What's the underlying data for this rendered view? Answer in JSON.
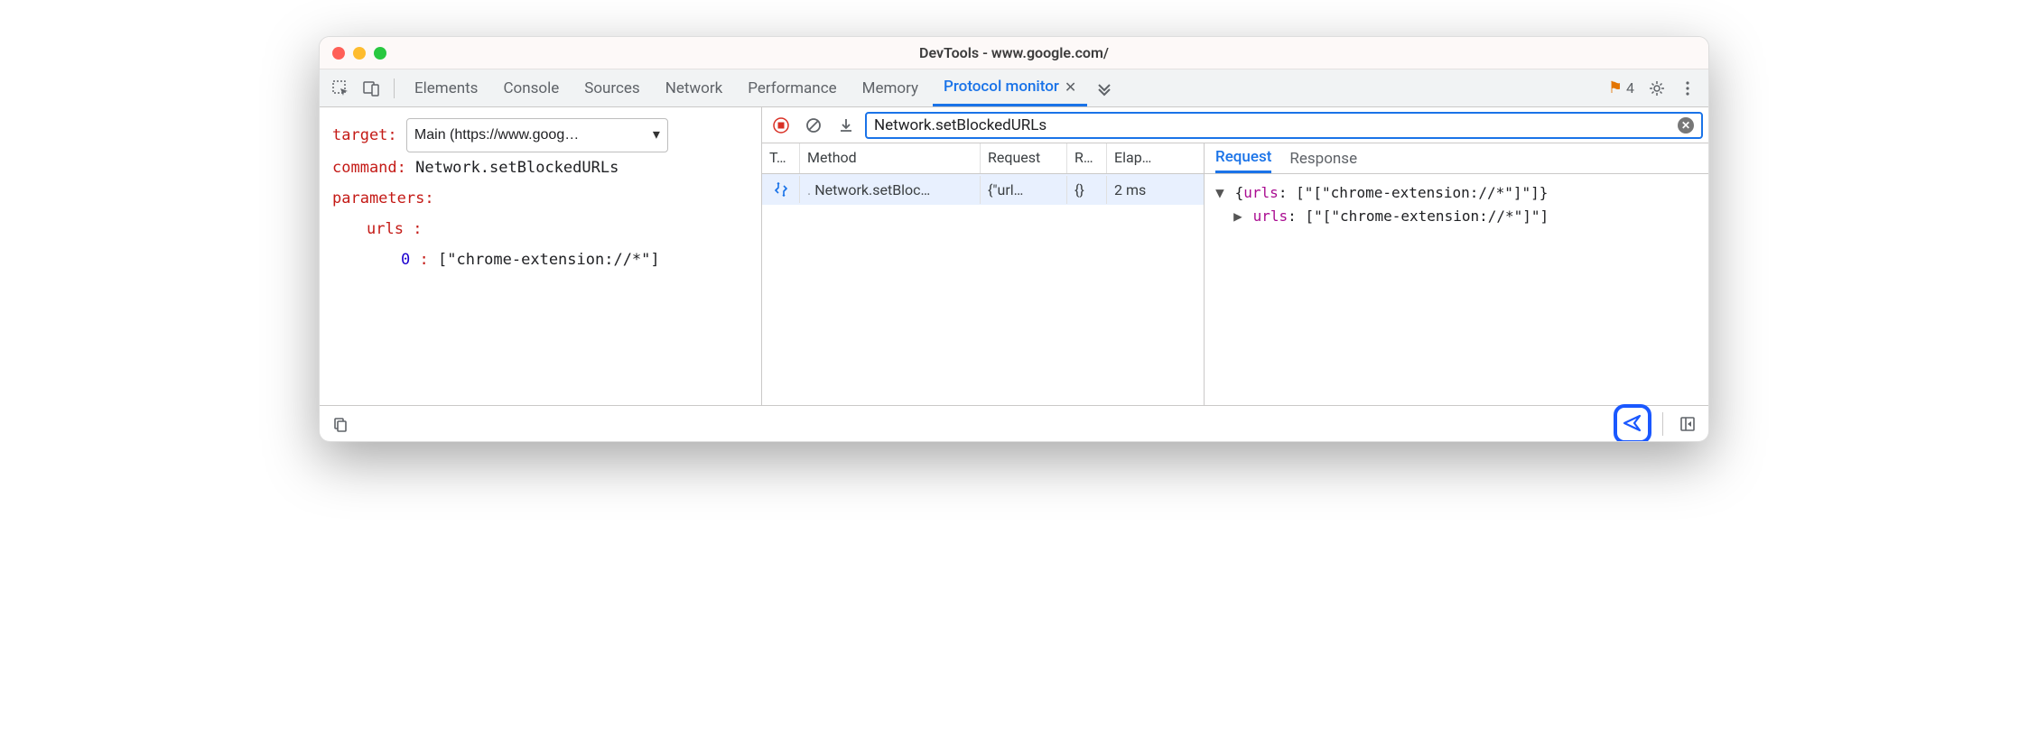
{
  "window": {
    "title": "DevTools - www.google.com/"
  },
  "tabs": {
    "items": [
      "Elements",
      "Console",
      "Sources",
      "Network",
      "Performance",
      "Memory",
      "Protocol monitor"
    ],
    "active": "Protocol monitor",
    "issues_count": "4"
  },
  "editor": {
    "target_label": "target",
    "target_value": "Main (https://www.goog…",
    "command_label": "command",
    "command_value": "Network.setBlockedURLs",
    "parameters_label": "parameters",
    "param_key": "urls",
    "param_index": "0",
    "param_value": "[\"chrome-extension://*\"]"
  },
  "toolbar": {
    "filter_value": "Network.setBlockedURLs"
  },
  "grid": {
    "headers": {
      "type": "T…",
      "method": "Method",
      "request": "Request",
      "r": "R…",
      "elapsed": "Elap…"
    },
    "row": {
      "method": "Network.setBloc…",
      "request": "{\"url…",
      "r": "{}",
      "elapsed": "2 ms"
    }
  },
  "detail": {
    "tabs": {
      "request": "Request",
      "response": "Response"
    },
    "line1_prefix": "{",
    "line1_key": "urls",
    "line1_val": "[\"[\"chrome-extension://*\"]\"]}",
    "line2_key": "urls",
    "line2_val": "[\"[\"chrome-extension://*\"]\"]"
  }
}
